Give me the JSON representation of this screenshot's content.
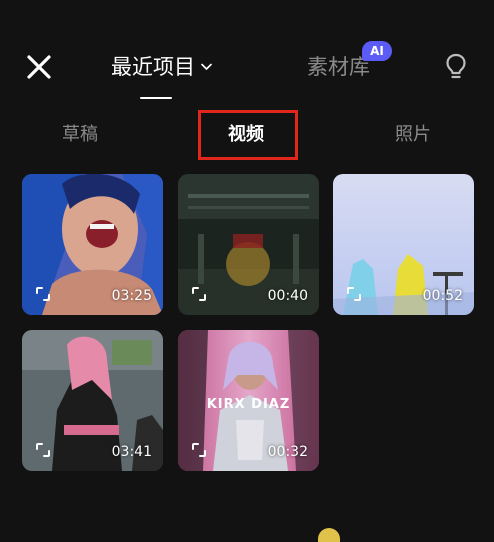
{
  "header": {
    "main_tab": "最近项目",
    "material_tab": "素材库",
    "ai_badge": "AI"
  },
  "subtabs": [
    {
      "label": "草稿",
      "active": false
    },
    {
      "label": "视频",
      "active": true
    },
    {
      "label": "照片",
      "active": false
    }
  ],
  "media": [
    {
      "duration": "03:25",
      "type": "video"
    },
    {
      "duration": "00:40",
      "type": "video"
    },
    {
      "duration": "00:52",
      "type": "video"
    },
    {
      "duration": "03:41",
      "type": "video"
    },
    {
      "duration": "00:32",
      "type": "video",
      "overlay_text": "KIRX DIAZ"
    }
  ],
  "icons": {
    "close": "close-icon",
    "dropdown": "chevron-down-icon",
    "tips": "lightbulb-icon",
    "select": "select-frame-icon"
  },
  "colors": {
    "background": "#121212",
    "ai_badge": "#5b5bf6",
    "highlight": "#e1261c",
    "inactive_text": "#8a8a8a"
  }
}
